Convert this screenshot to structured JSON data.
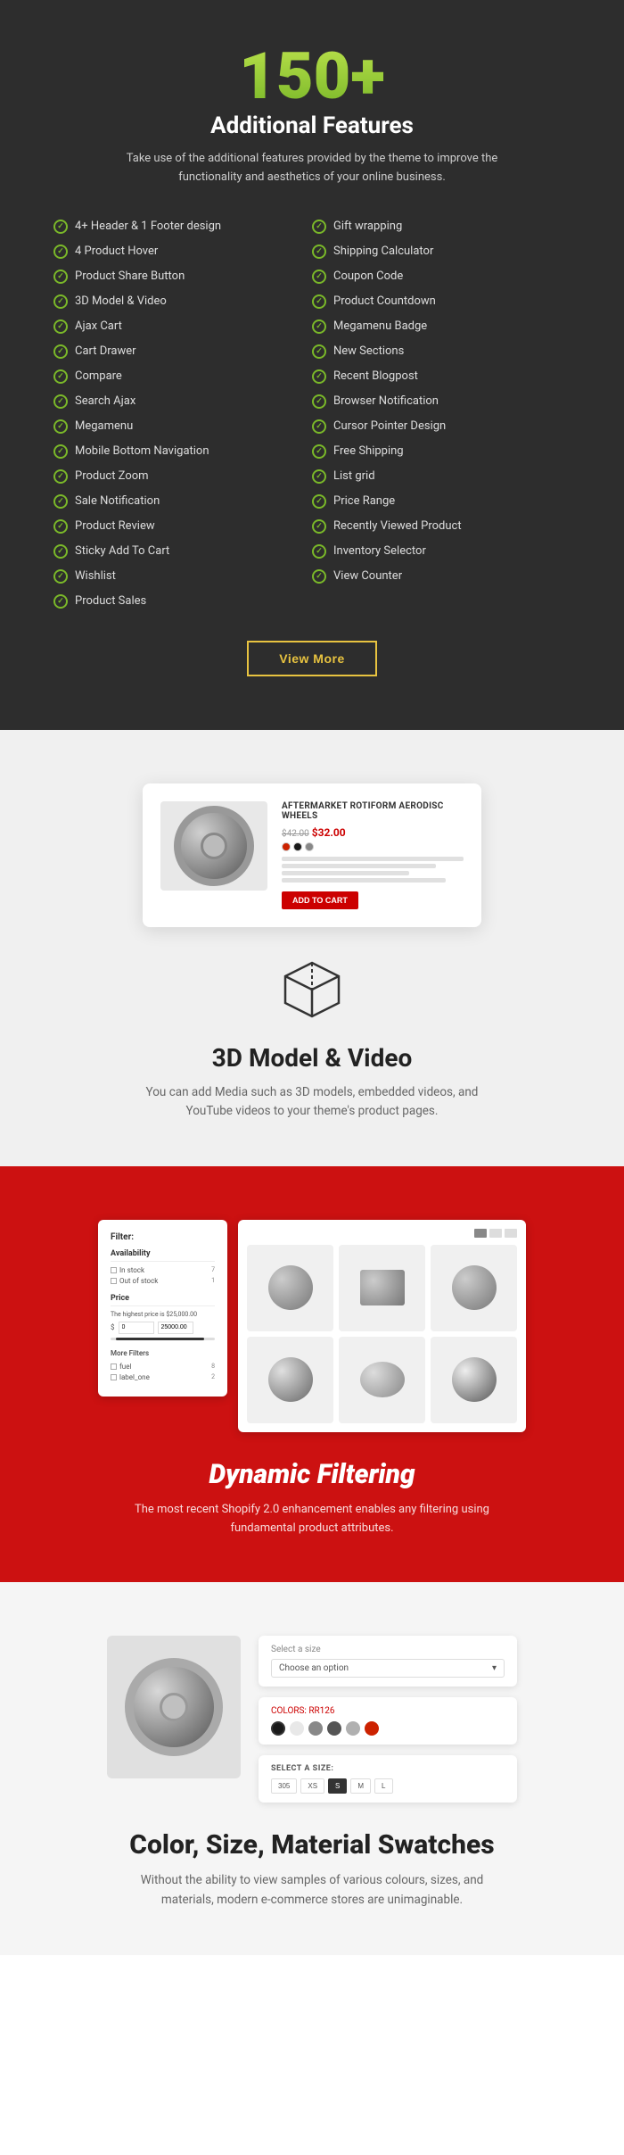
{
  "features_section": {
    "headline": "150+",
    "subtitle": "Additional Features",
    "description": "Take use of the additional features provided by the theme to improve the functionality and aesthetics of your online business.",
    "col1": [
      "4+ Header & 1 Footer design",
      "4 Product Hover",
      "Product Share Button",
      "3D Model & Video",
      "Ajax Cart",
      "Cart Drawer",
      "Compare",
      "Search Ajax",
      "Megamenu",
      "Mobile Bottom Navigation",
      "Product Zoom",
      "Sale Notification",
      "Product Review",
      "Sticky Add To Cart",
      "Wishlist",
      "Product Sales"
    ],
    "col2": [
      "Gift wrapping",
      "Shipping Calculator",
      "Coupon Code",
      "Product Countdown",
      "Megamenu Badge",
      "New Sections",
      "Recent Blogpost",
      "Browser Notification",
      "Cursor Pointer Design",
      "Free Shipping",
      "List grid",
      "Price Range",
      "Recently Viewed Product",
      "Inventory Selector",
      "View Counter"
    ],
    "btn_label": "View More"
  },
  "section_3d": {
    "product_title": "AFTERMARKET ROTIFORM AERODISC WHEELS",
    "old_price": "$42.00",
    "new_price": "$32.00",
    "title": "3D Model & Video",
    "description": "You can add Media such as 3D models, embedded videos, and YouTube videos to your theme's product pages."
  },
  "section_filtering": {
    "filter_label": "Filter:",
    "availability_label": "Availability",
    "in_stock_label": "In stock",
    "in_stock_count": "7",
    "out_stock_label": "Out of stock",
    "out_stock_count": "1",
    "price_label": "Price",
    "price_desc": "The highest price is $25,000.00",
    "price_from": "0",
    "price_to": "25000.00",
    "more_filters": "More Filters",
    "filter1_label": "fuel",
    "filter1_count": "8",
    "filter2_label": "label_one",
    "filter2_count": "2",
    "title": "Dynamic Filtering",
    "description": "The most recent Shopify 2.0 enhancement enables any filtering using fundamental product attributes."
  },
  "section_swatches": {
    "select_size_label": "Select a size",
    "choose_option": "Choose an option",
    "colors_label": "COLORS:",
    "colors_value": "RR126",
    "colors": [
      {
        "color": "#1a1a1a",
        "active": true
      },
      {
        "color": "#e8e8e8",
        "active": false
      },
      {
        "color": "#888888",
        "active": false
      },
      {
        "color": "#555555",
        "active": false
      },
      {
        "color": "#b0b0b0",
        "active": false
      },
      {
        "color": "#cc2200",
        "active": false
      }
    ],
    "size_label": "SELECT A SIZE:",
    "sizes": [
      "305",
      "XS",
      "S",
      "M",
      "L"
    ],
    "active_size": "S",
    "title": "Color, Size, Material Swatches",
    "description": "Without the ability to view samples of various colours, sizes, and materials, modern e-commerce stores are unimaginable."
  }
}
